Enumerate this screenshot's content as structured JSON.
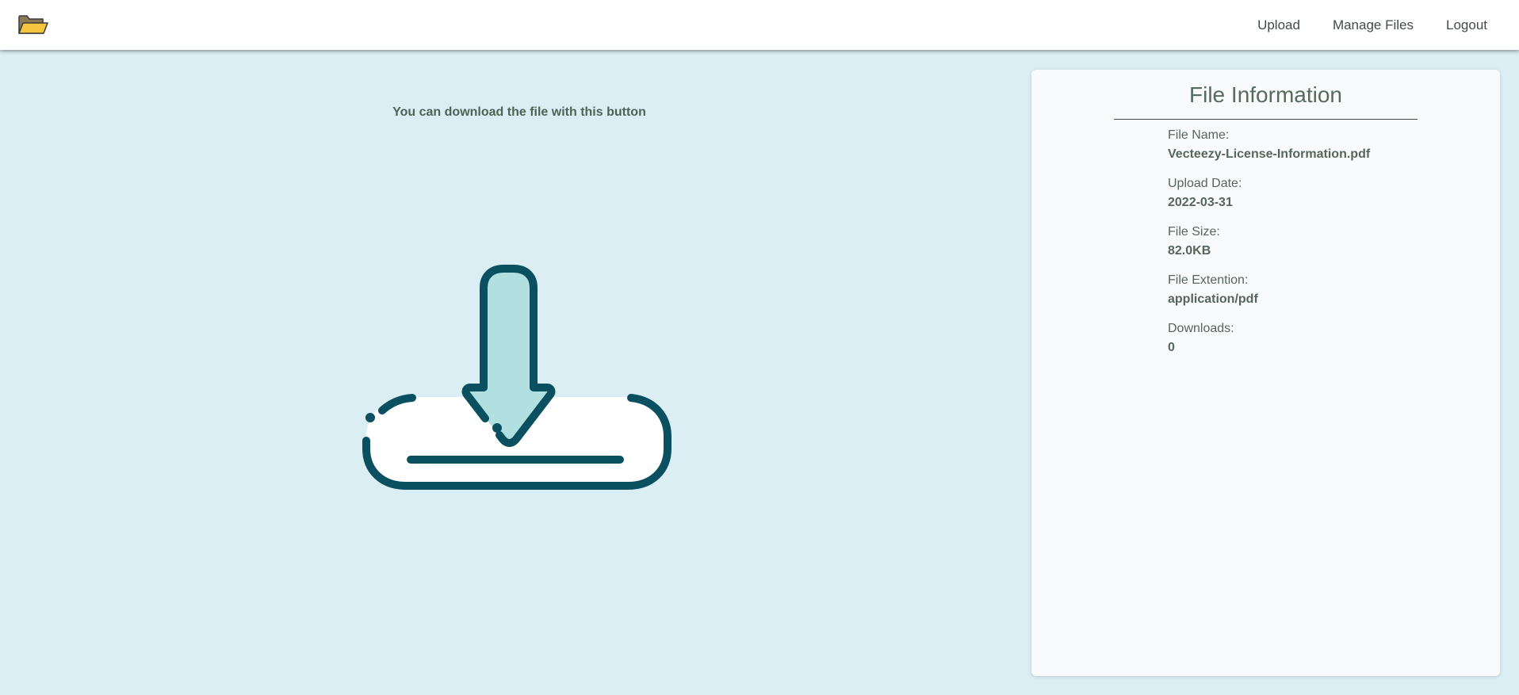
{
  "nav": {
    "logo_icon": "folder-open-icon",
    "links": [
      "Upload",
      "Manage Files",
      "Logout"
    ]
  },
  "main": {
    "caption": "You can download the file with this button",
    "download_icon": "download-tray-icon"
  },
  "info": {
    "title": "File Information",
    "fields": [
      {
        "label": "File Name:",
        "value": "Vecteezy-License-Information.pdf"
      },
      {
        "label": "Upload Date:",
        "value": "2022-03-31"
      },
      {
        "label": "File Size:",
        "value": "82.0KB"
      },
      {
        "label": "File Extention:",
        "value": "application/pdf"
      },
      {
        "label": "Downloads:",
        "value": "0"
      }
    ]
  },
  "colors": {
    "page_bg": "#daeef3",
    "card_bg": "#f8fafc",
    "icon_stroke": "#0b5060",
    "icon_fill": "#b2dfe0",
    "folder_fill": "#f7c63f"
  }
}
